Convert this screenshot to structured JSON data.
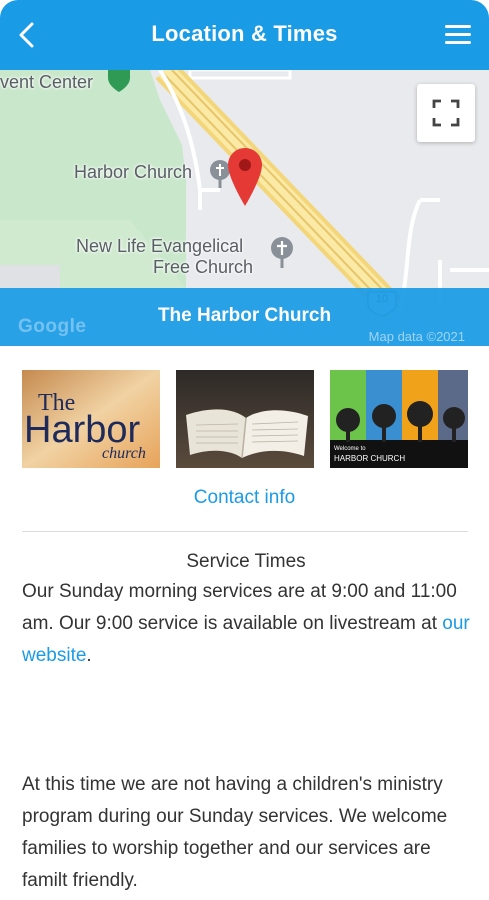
{
  "appbar": {
    "title": "Location & Times",
    "back_icon": "chevron-left-icon",
    "menu_icon": "hamburger-menu-icon",
    "color": "#1a9be6"
  },
  "map": {
    "labels": {
      "event_center": "vent Center",
      "harbor_church": "Harbor Church",
      "new_life_line1": "New Life Evangelical",
      "new_life_line2": "Free Church",
      "route": "10"
    },
    "banner_title": "The Harbor Church",
    "google_logo": "Google",
    "attribution": "Map data ©2021",
    "fullscreen_icon": "fullscreen-icon",
    "pin_icon": "location-pin-icon",
    "pin_color": "#e53935"
  },
  "gallery": {
    "harbor_logo": {
      "the": "The",
      "harbor": "Harbor",
      "church": "church"
    },
    "banner": {
      "welcome": "Welcome to",
      "name": "HARBOR CHURCH"
    }
  },
  "contact_link": "Contact info",
  "service": {
    "heading": "Service Times",
    "para1_before": "Our Sunday morning services are at 9:00 and 11:00 am. Our 9:00 service is available on livestream at ",
    "para1_link": "our website",
    "para1_after": ".",
    "para2": "At this time we are not having a children's ministry program during our Sunday services. We welcome families to worship together and our services are familt friendly."
  },
  "link_color": "#1a9be6"
}
